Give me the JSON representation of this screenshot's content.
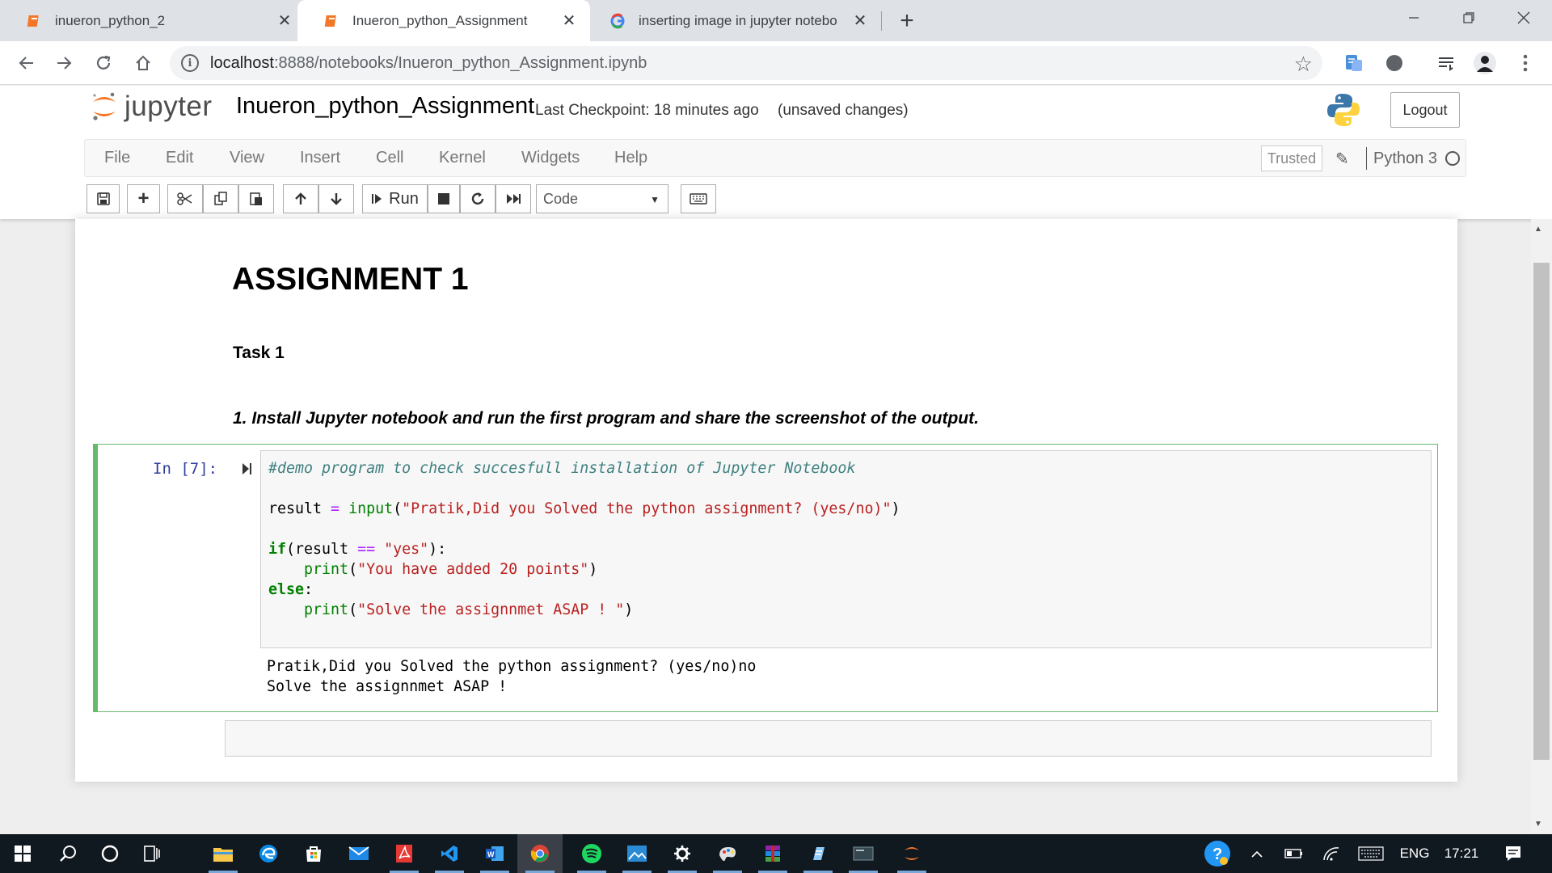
{
  "browser": {
    "tabs": [
      {
        "title": "inueron_python_2",
        "active": false
      },
      {
        "title": "Inueron_python_Assignment",
        "active": true
      },
      {
        "title": "inserting image in jupyter notebo",
        "active": false
      }
    ],
    "url_host": "localhost",
    "url_path": ":8888/notebooks/Inueron_python_Assignment.ipynb"
  },
  "jupyter": {
    "logo_text": "jupyter",
    "notebook_name": "Inueron_python_Assignment",
    "checkpoint": "Last Checkpoint: 18 minutes ago",
    "status": "(unsaved changes)",
    "logout": "Logout",
    "menu": [
      "File",
      "Edit",
      "View",
      "Insert",
      "Cell",
      "Kernel",
      "Widgets",
      "Help"
    ],
    "trusted": "Trusted",
    "kernel": "Python 3",
    "run_label": "Run",
    "cell_type": "Code"
  },
  "content": {
    "heading": "ASSIGNMENT 1",
    "subheading": "Task 1",
    "task_text": "1. Install Jupyter notebook and run the first program and share the screenshot of the output.",
    "prompt": "In [7]:",
    "code": {
      "comment": "#demo program to check succesfull installation of Jupyter Notebook",
      "l3_a": "result ",
      "l3_op": "=",
      "l3_b": " ",
      "l3_fn": "input",
      "l3_c": "(",
      "l3_str": "\"Pratik,Did you Solved the python assignment? (yes/no)\"",
      "l3_d": ")",
      "l5_kw": "if",
      "l5_a": "(result ",
      "l5_op": "==",
      "l5_b": " ",
      "l5_str": "\"yes\"",
      "l5_c": "):",
      "l6_indent": "    ",
      "l6_fn": "print",
      "l6_a": "(",
      "l6_str": "\"You have added 20 points\"",
      "l6_b": ")",
      "l7_kw": "else",
      "l7_a": ":",
      "l8_indent": "    ",
      "l8_fn": "print",
      "l8_a": "(",
      "l8_str": "\"Solve the assignnmet ASAP ! \"",
      "l8_b": ")"
    },
    "output": [
      "Pratik,Did you Solved the python assignment? (yes/no)no",
      "Solve the assignnmet ASAP !"
    ]
  },
  "taskbar": {
    "language": "ENG",
    "time": "17:21"
  }
}
